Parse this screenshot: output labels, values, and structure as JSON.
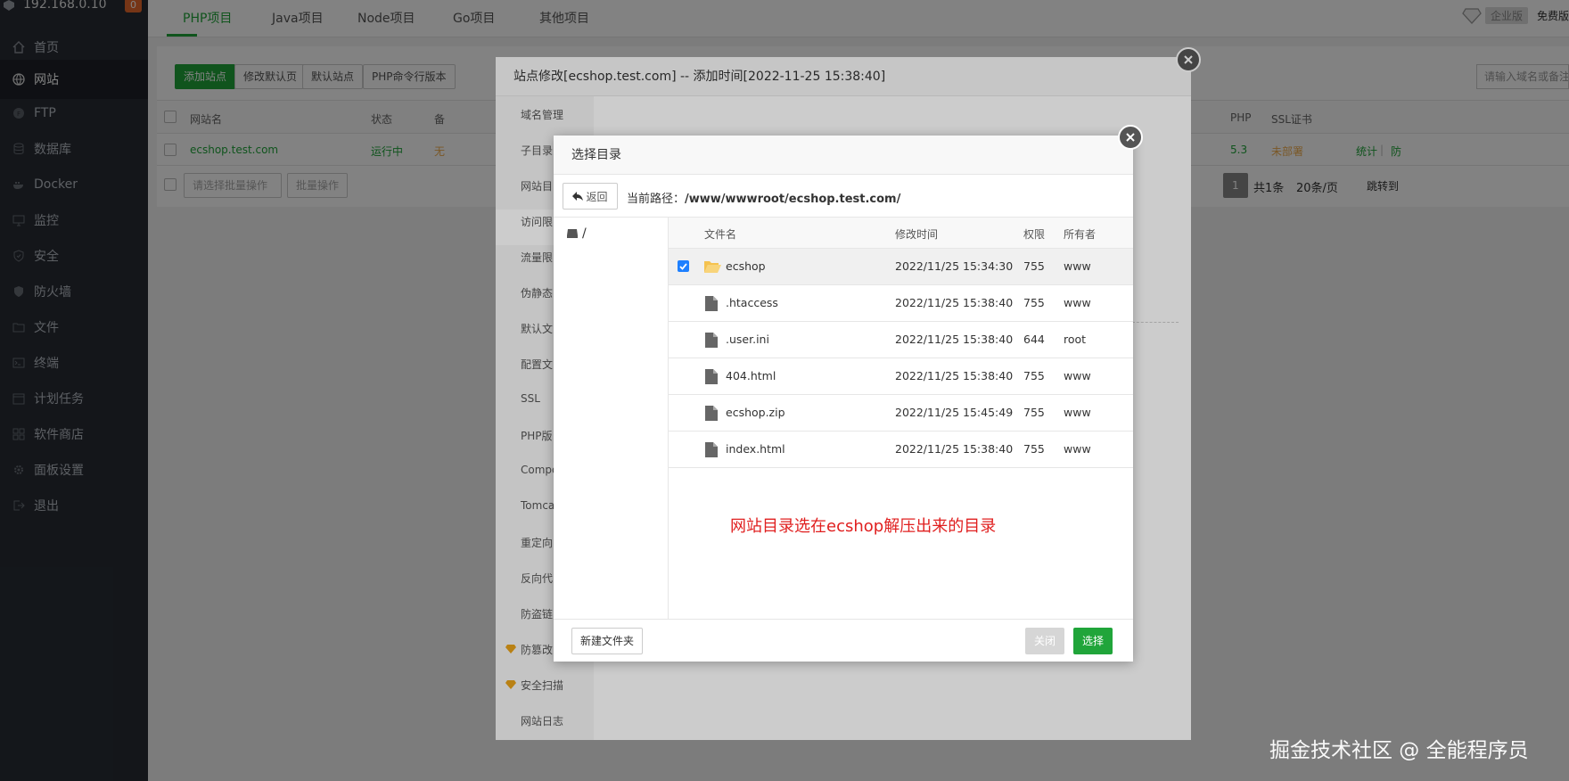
{
  "sidebar": {
    "ip": "192.168.0.10",
    "badge": "0",
    "items": [
      {
        "label": "首页",
        "icon": "home-icon"
      },
      {
        "label": "网站",
        "icon": "globe-icon"
      },
      {
        "label": "FTP",
        "icon": "ftp-icon"
      },
      {
        "label": "数据库",
        "icon": "database-icon"
      },
      {
        "label": "Docker",
        "icon": "docker-icon"
      },
      {
        "label": "监控",
        "icon": "monitor-icon"
      },
      {
        "label": "安全",
        "icon": "shield-icon"
      },
      {
        "label": "防火墙",
        "icon": "firewall-icon"
      },
      {
        "label": "文件",
        "icon": "folder-icon"
      },
      {
        "label": "终端",
        "icon": "terminal-icon"
      },
      {
        "label": "计划任务",
        "icon": "calendar-icon"
      },
      {
        "label": "软件商店",
        "icon": "apps-icon"
      },
      {
        "label": "面板设置",
        "icon": "gear-icon"
      },
      {
        "label": "退出",
        "icon": "logout-icon"
      }
    ]
  },
  "topnav": {
    "tabs": [
      "PHP项目",
      "Java项目",
      "Node项目",
      "Go项目",
      "其他项目"
    ],
    "enterprise": "企业版",
    "free": "免费版"
  },
  "toolbar": {
    "add_site": "添加站点",
    "edit_default": "修改默认页",
    "default_site": "默认站点",
    "php_cli": "PHP命令行版本",
    "search_placeholder": "请输入域名或备注"
  },
  "site_table": {
    "headers": {
      "name": "网站名",
      "status": "状态",
      "remark": "备",
      "php": "PHP",
      "ssl": "SSL证书"
    },
    "row": {
      "name": "ecshop.test.com",
      "status": "运行中",
      "remark": "无",
      "php": "5.3",
      "ssl": "未部署",
      "stats": "统计",
      "sep": "|",
      "more": "防"
    },
    "batch_select": "请选择批量操作",
    "batch_btn": "批量操作",
    "pagination": {
      "page": "1",
      "total": "共1条",
      "per_page": "20条/页",
      "jump": "跳转到"
    }
  },
  "site_modal": {
    "title": "站点修改[ecshop.test.com] -- 添加时间[2022-11-25 15:38:40]",
    "menu": [
      "域名管理",
      "子目录",
      "网站目",
      "访问限",
      "流量限",
      "伪静态",
      "默认文",
      "配置文",
      "SSL",
      "PHP版",
      "Compo",
      "Tomca",
      "重定向",
      "反向代",
      "防盗链",
      "防篡改",
      "安全扫描",
      "网站日志"
    ]
  },
  "dir_modal": {
    "title": "选择目录",
    "back": "返回",
    "path_label": "当前路径：",
    "path": "/www/wwwroot/ecshop.test.com/",
    "tree_root": "/",
    "headers": {
      "name": "文件名",
      "mtime": "修改时间",
      "perm": "权限",
      "owner": "所有者"
    },
    "files": [
      {
        "name": "ecshop",
        "mtime": "2022/11/25 15:34:30",
        "perm": "755",
        "owner": "www",
        "type": "folder"
      },
      {
        "name": ".htaccess",
        "mtime": "2022/11/25 15:38:40",
        "perm": "755",
        "owner": "www",
        "type": "file"
      },
      {
        "name": ".user.ini",
        "mtime": "2022/11/25 15:38:40",
        "perm": "644",
        "owner": "root",
        "type": "file"
      },
      {
        "name": "404.html",
        "mtime": "2022/11/25 15:38:40",
        "perm": "755",
        "owner": "www",
        "type": "file"
      },
      {
        "name": "ecshop.zip",
        "mtime": "2022/11/25 15:45:49",
        "perm": "755",
        "owner": "www",
        "type": "file"
      },
      {
        "name": "index.html",
        "mtime": "2022/11/25 15:38:40",
        "perm": "755",
        "owner": "www",
        "type": "file"
      }
    ],
    "note": "网站目录选在ecshop解压出来的目录",
    "new_folder": "新建文件夹",
    "close": "关闭",
    "select": "选择"
  },
  "watermark": "掘金技术社区 @ 全能程序员",
  "colors": {
    "accent": "#20a53a",
    "sidebar_bg": "#282c34",
    "note": "#e02020"
  }
}
